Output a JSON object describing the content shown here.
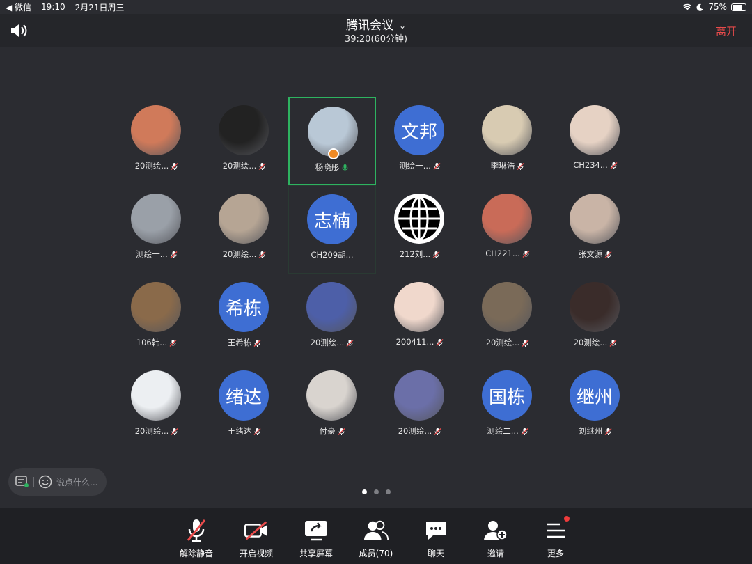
{
  "status": {
    "carrier": "◀ 微信",
    "time": "19:10",
    "date": "2月21日周三",
    "battery": "75%",
    "battery_level": 0.75
  },
  "header": {
    "title": "腾讯会议",
    "timer": "39:20(60分钟)",
    "leave_label": "离开"
  },
  "colors": {
    "accent": "#3e6ed3",
    "active_border": "#2eb360",
    "leave": "#e94b4b"
  },
  "participants": [
    {
      "name": "20测绘...",
      "avatar": "photo",
      "color": "#d07a5a",
      "muted": true
    },
    {
      "name": "20测绘...",
      "avatar": "photo",
      "color": "#222222",
      "muted": true
    },
    {
      "name": "杨晓彤",
      "avatar": "photo",
      "color": "#b9c8d6",
      "muted": false,
      "speaking": true,
      "host": true
    },
    {
      "name": "测绘一...",
      "avatar": "文邦",
      "muted": true
    },
    {
      "name": "李琳浩",
      "avatar": "photo",
      "color": "#d8cbb2",
      "muted": true
    },
    {
      "name": "CH234...",
      "avatar": "photo",
      "color": "#e6d2c4",
      "muted": true
    },
    {
      "name": "测绘一...",
      "avatar": "photo",
      "color": "#9aa0a8",
      "muted": true
    },
    {
      "name": "20测绘...",
      "avatar": "photo",
      "color": "#b6a594",
      "muted": true
    },
    {
      "name": "CH209胡...",
      "avatar": "志楠",
      "muted": false
    },
    {
      "name": "212刘...",
      "avatar": "globe",
      "muted": true
    },
    {
      "name": "CH221...",
      "avatar": "photo",
      "color": "#c96b58",
      "muted": true
    },
    {
      "name": "张文源",
      "avatar": "photo",
      "color": "#c9b4a6",
      "muted": true
    },
    {
      "name": "106韩...",
      "avatar": "photo",
      "color": "#8a6a4a",
      "muted": true
    },
    {
      "name": "王希栋",
      "avatar": "希栋",
      "muted": true
    },
    {
      "name": "20测绘...",
      "avatar": "photo",
      "color": "#4d5fa8",
      "muted": true
    },
    {
      "name": "200411...",
      "avatar": "photo",
      "color": "#f0d8cc",
      "muted": true
    },
    {
      "name": "20测绘...",
      "avatar": "photo",
      "color": "#7a6a58",
      "muted": true
    },
    {
      "name": "20测绘...",
      "avatar": "photo",
      "color": "#3a2c2a",
      "muted": true
    },
    {
      "name": "20测绘...",
      "avatar": "photo",
      "color": "#eceff2",
      "muted": true
    },
    {
      "name": "王绪达",
      "avatar": "绪达",
      "muted": true
    },
    {
      "name": "付豪",
      "avatar": "photo",
      "color": "#d9d4cf",
      "muted": true
    },
    {
      "name": "20测绘...",
      "avatar": "photo",
      "color": "#6b6fa8",
      "muted": true
    },
    {
      "name": "测绘二...",
      "avatar": "国栋",
      "muted": true
    },
    {
      "name": "刘继州",
      "avatar": "继州",
      "muted": true
    }
  ],
  "chat": {
    "placeholder": "说点什么..."
  },
  "pages": {
    "count": 3,
    "current": 1
  },
  "toolbar": [
    {
      "label": "解除静音",
      "icon": "mic-muted-icon"
    },
    {
      "label": "开启视频",
      "icon": "video-off-icon"
    },
    {
      "label": "共享屏幕",
      "icon": "share-screen-icon"
    },
    {
      "label": "成员(70)",
      "icon": "members-icon"
    },
    {
      "label": "聊天",
      "icon": "chat-icon"
    },
    {
      "label": "邀请",
      "icon": "invite-icon"
    },
    {
      "label": "更多",
      "icon": "more-icon",
      "badge": true
    }
  ]
}
